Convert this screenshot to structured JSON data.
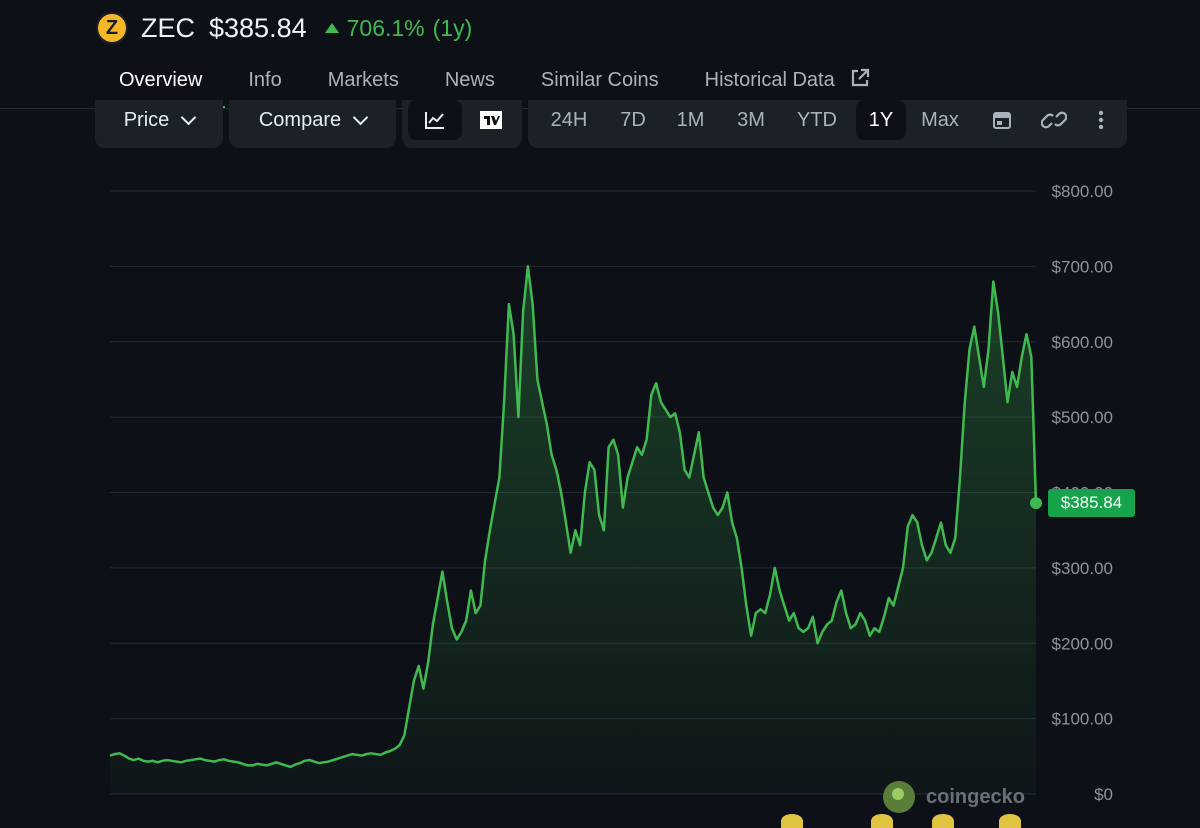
{
  "coin": {
    "logo_letter": "Z",
    "symbol": "ZEC",
    "price": "$385.84",
    "change": "706.1%",
    "change_period": "(1y)",
    "up_color": "#3fb950",
    "logo_color": "#f4b728"
  },
  "tabs": [
    {
      "label": "Overview",
      "active": true
    },
    {
      "label": "Info"
    },
    {
      "label": "Markets"
    },
    {
      "label": "News"
    },
    {
      "label": "Similar Coins"
    },
    {
      "label": "Historical Data",
      "icon": "external-link-icon"
    }
  ],
  "controls": {
    "price_label": "Price",
    "compare_label": "Compare",
    "chart_type_icons": [
      "line-chart-icon",
      "tradingview-icon"
    ],
    "ranges": [
      "24H",
      "7D",
      "1M",
      "3M",
      "YTD",
      "1Y",
      "Max"
    ],
    "active_range": "1Y",
    "extra_icons": [
      "calendar-icon",
      "link-icon",
      "more-vertical-icon"
    ]
  },
  "watermark": "coingecko",
  "chart_data": {
    "type": "area",
    "line_color": "#3fb950",
    "y_ticks": [
      "$800.00",
      "$700.00",
      "$600.00",
      "$500.00",
      "$400.00",
      "$300.00",
      "$200.00",
      "$100.00",
      "$0"
    ],
    "ylim": [
      0,
      800
    ],
    "grid": true,
    "current_value_label": "$385.84",
    "current_value": 385.84,
    "series": [
      {
        "values": [
          51,
          53,
          54,
          51,
          47,
          45,
          47,
          44,
          43,
          44,
          42,
          44,
          45,
          44,
          43,
          42,
          44,
          45,
          46,
          47,
          45,
          44,
          43,
          45,
          46,
          44,
          43,
          42,
          40,
          38,
          38,
          40,
          39,
          38,
          40,
          42,
          40,
          38,
          36,
          39,
          41,
          44,
          45,
          43,
          41,
          42,
          43,
          45,
          47,
          49,
          51,
          53,
          52,
          51,
          53,
          54,
          53,
          52,
          55,
          57,
          60,
          65,
          78,
          115,
          150,
          170,
          140,
          175,
          225,
          260,
          295,
          255,
          220,
          205,
          215,
          230,
          270,
          240,
          250,
          310,
          350,
          385,
          420,
          520,
          650,
          610,
          500,
          640,
          700,
          650,
          550,
          520,
          490,
          450,
          430,
          400,
          360,
          320,
          350,
          330,
          400,
          440,
          430,
          370,
          350,
          460,
          470,
          450,
          380,
          420,
          440,
          460,
          450,
          470,
          530,
          545,
          520,
          510,
          500,
          505,
          480,
          430,
          420,
          450,
          480,
          420,
          400,
          380,
          370,
          380,
          400,
          360,
          340,
          300,
          250,
          210,
          240,
          245,
          240,
          265,
          300,
          270,
          250,
          230,
          240,
          220,
          215,
          220,
          235,
          200,
          215,
          225,
          230,
          255,
          270,
          240,
          220,
          225,
          240,
          230,
          210,
          220,
          215,
          235,
          260,
          250,
          275,
          300,
          355,
          370,
          360,
          330,
          310,
          320,
          340,
          360,
          330,
          320,
          340,
          420,
          520,
          590,
          620,
          580,
          540,
          590,
          680,
          640,
          580,
          520,
          560,
          540,
          580,
          610,
          580,
          385.84
        ]
      }
    ]
  }
}
